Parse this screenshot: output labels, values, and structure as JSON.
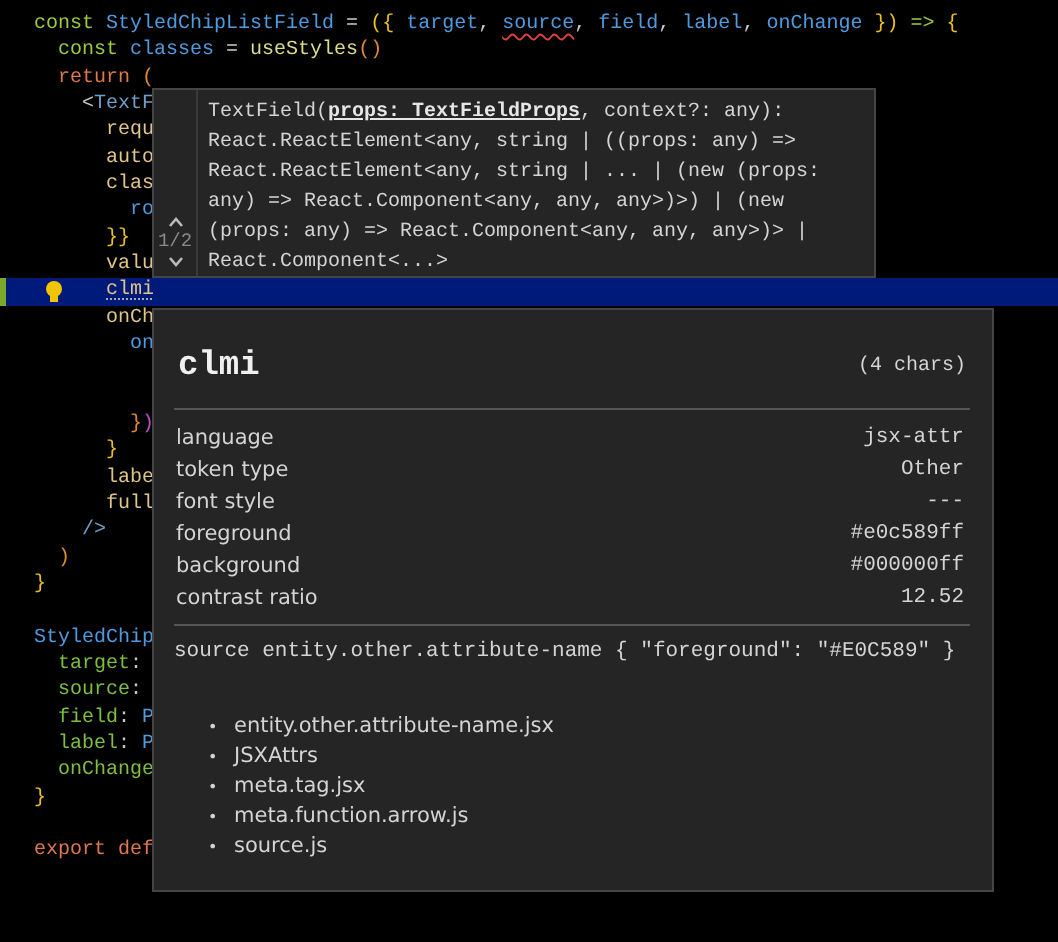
{
  "editor": {
    "lines": [
      {
        "kind": "code",
        "tokens": [
          {
            "text": "const ",
            "kind": "keyword"
          },
          {
            "text": "StyledChipListField",
            "kind": "name"
          },
          {
            "text": " = ",
            "kind": "op"
          },
          {
            "text": "({ ",
            "kind": "bracket"
          },
          {
            "text": "target",
            "kind": "name"
          },
          {
            "text": ", ",
            "kind": "op"
          },
          {
            "text": "source",
            "kind": "name",
            "squiggle": true
          },
          {
            "text": ", ",
            "kind": "op"
          },
          {
            "text": "field",
            "kind": "name"
          },
          {
            "text": ", ",
            "kind": "op"
          },
          {
            "text": "label",
            "kind": "name"
          },
          {
            "text": ", ",
            "kind": "op"
          },
          {
            "text": "onChange",
            "kind": "name"
          },
          {
            "text": " })",
            "kind": "bracket"
          },
          {
            "text": " => ",
            "kind": "keyword"
          },
          {
            "text": "{",
            "kind": "bracket"
          }
        ],
        "children": [
          {
            "kind": "code",
            "tokens": [
              {
                "text": "const ",
                "kind": "keyword"
              },
              {
                "text": "classes",
                "kind": "name"
              },
              {
                "text": " = ",
                "kind": "op"
              },
              {
                "text": "useStyles",
                "kind": "func"
              },
              {
                "text": "()",
                "kind": "bracket2"
              }
            ]
          },
          {
            "kind": "code",
            "tokens": [
              {
                "text": "return ",
                "kind": "control"
              },
              {
                "text": "(",
                "kind": "bracket2"
              }
            ],
            "children": [
              {
                "kind": "code",
                "tokens": [
                  {
                    "text": "<",
                    "kind": "op"
                  },
                  {
                    "text": "TextF",
                    "kind": "tag"
                  }
                ],
                "children": [
                  {
                    "kind": "code",
                    "tokens": [
                      {
                        "text": "requ",
                        "kind": "attr"
                      }
                    ]
                  },
                  {
                    "kind": "code",
                    "tokens": [
                      {
                        "text": "auto",
                        "kind": "attr"
                      }
                    ]
                  },
                  {
                    "kind": "code",
                    "tokens": [
                      {
                        "text": "clas",
                        "kind": "attr"
                      }
                    ],
                    "children": [
                      {
                        "kind": "code",
                        "tokens": [
                          {
                            "text": "ro",
                            "kind": "name"
                          }
                        ]
                      }
                    ]
                  },
                  {
                    "kind": "code",
                    "tokens": [
                      {
                        "text": "}}",
                        "kind": "bracket"
                      }
                    ]
                  },
                  {
                    "kind": "code",
                    "tokens": [
                      {
                        "text": "valu",
                        "kind": "attr"
                      }
                    ]
                  },
                  {
                    "kind": "code",
                    "highlighted": true,
                    "modified": true,
                    "lightbulb": true,
                    "tokens": [
                      {
                        "text": "clmi",
                        "kind": "attr",
                        "dotted": true
                      }
                    ]
                  },
                  {
                    "kind": "code",
                    "tokens": [
                      {
                        "text": "onCh",
                        "kind": "attr"
                      }
                    ],
                    "children": [
                      {
                        "kind": "code",
                        "tokens": [
                          {
                            "text": "on",
                            "kind": "name"
                          }
                        ]
                      },
                      {
                        "kind": "blank"
                      },
                      {
                        "kind": "blank"
                      },
                      {
                        "kind": "code",
                        "tokens": [
                          {
                            "text": "}",
                            "kind": "bracket2"
                          },
                          {
                            "text": ")",
                            "kind": "bracket3"
                          }
                        ]
                      }
                    ]
                  },
                  {
                    "kind": "code",
                    "tokens": [
                      {
                        "text": "}",
                        "kind": "bracket"
                      }
                    ]
                  },
                  {
                    "kind": "code",
                    "tokens": [
                      {
                        "text": "labe",
                        "kind": "attr"
                      }
                    ]
                  },
                  {
                    "kind": "code",
                    "tokens": [
                      {
                        "text": "full",
                        "kind": "attr"
                      }
                    ]
                  }
                ]
              },
              {
                "kind": "code",
                "tokens": [
                  {
                    "text": "/>",
                    "kind": "tag"
                  }
                ]
              }
            ]
          },
          {
            "kind": "code",
            "tokens": [
              {
                "text": ")",
                "kind": "bracket2"
              }
            ]
          }
        ]
      },
      {
        "kind": "code",
        "tokens": [
          {
            "text": "}",
            "kind": "bracket"
          }
        ]
      },
      {
        "kind": "blank"
      },
      {
        "kind": "code",
        "tokens": [
          {
            "text": "StyledChip",
            "kind": "name"
          }
        ],
        "children": [
          {
            "kind": "code",
            "tokens": [
              {
                "text": "target",
                "kind": "prop"
              },
              {
                "text": ":",
                "kind": "op"
              }
            ]
          },
          {
            "kind": "code",
            "tokens": [
              {
                "text": "source",
                "kind": "prop"
              },
              {
                "text": ":",
                "kind": "op"
              }
            ]
          },
          {
            "kind": "code",
            "tokens": [
              {
                "text": "field",
                "kind": "prop"
              },
              {
                "text": ": ",
                "kind": "op"
              },
              {
                "text": "P",
                "kind": "name"
              }
            ]
          },
          {
            "kind": "code",
            "tokens": [
              {
                "text": "label",
                "kind": "prop"
              },
              {
                "text": ": ",
                "kind": "op"
              },
              {
                "text": "P",
                "kind": "name"
              }
            ]
          },
          {
            "kind": "code",
            "tokens": [
              {
                "text": "onChange",
                "kind": "prop"
              }
            ]
          }
        ]
      },
      {
        "kind": "code",
        "tokens": [
          {
            "text": "}",
            "kind": "bracket"
          }
        ]
      },
      {
        "kind": "blank"
      },
      {
        "kind": "code",
        "tokens": [
          {
            "text": "export def",
            "kind": "control"
          }
        ]
      }
    ]
  },
  "signature_help": {
    "counter": "1/2",
    "lines": [
      "TextField(**props: TextFieldProps**, context?: any):",
      "React.ReactElement<any, string | ((props: any) =>",
      "React.ReactElement<any, string | ... | (new (props:",
      "any) => React.Component<any, any, any>)>) | (new",
      "(props: any) => React.Component<any, any, any>)> |",
      "React.Component<...>"
    ]
  },
  "inspector": {
    "token": "clmi",
    "length": "(4 chars)",
    "rows": [
      {
        "label": "language",
        "value": "jsx-attr"
      },
      {
        "label": "token type",
        "value": "Other"
      },
      {
        "label": "font style",
        "value": "---"
      },
      {
        "label": "foreground",
        "value": "#e0c589ff"
      },
      {
        "label": "background",
        "value": "#000000ff"
      },
      {
        "label": "contrast ratio",
        "value": "12.52"
      }
    ],
    "source": "source entity.other.attribute-name { \"foreground\": \"#E0C589\" }",
    "scopes": [
      {
        "bullet": "•",
        "text": "entity.other.attribute-name.jsx"
      },
      {
        "bullet": "•",
        "text": "JSXAttrs"
      },
      {
        "bullet": "•",
        "text": "meta.tag.jsx"
      },
      {
        "bullet": "•",
        "text": "meta.function.arrow.js"
      },
      {
        "bullet": "•",
        "text": "source.js"
      }
    ]
  }
}
